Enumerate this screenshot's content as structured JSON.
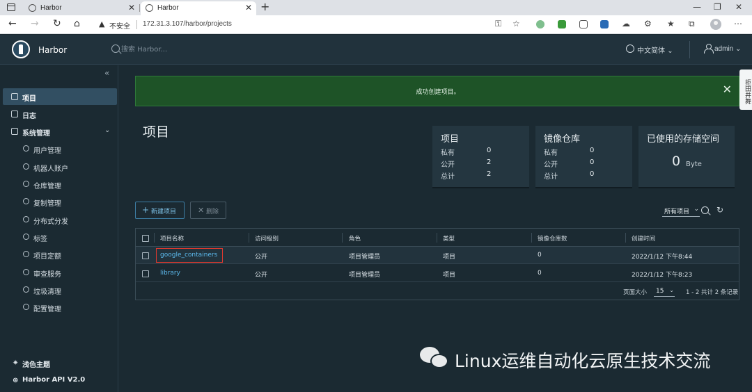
{
  "browser": {
    "tabs": [
      {
        "title": "Harbor",
        "active": false
      },
      {
        "title": "Harbor",
        "active": true
      }
    ],
    "insecure_label": "不安全",
    "url": "172.31.3.107/harbor/projects"
  },
  "header": {
    "brand": "Harbor",
    "search_placeholder": "搜索 Harbor...",
    "language": "中文简体",
    "user": "admin"
  },
  "sidebar": {
    "collapse_icon": "«",
    "items": [
      {
        "label": "项目",
        "icon": "projects-icon",
        "active": true
      },
      {
        "label": "日志",
        "icon": "logs-icon",
        "active": false
      },
      {
        "label": "系统管理",
        "icon": "admin-icon",
        "active": false
      }
    ],
    "sub_items": [
      {
        "label": "用户管理",
        "icon": "users-icon"
      },
      {
        "label": "机器人账户",
        "icon": "robot-icon"
      },
      {
        "label": "仓库管理",
        "icon": "registry-icon"
      },
      {
        "label": "复制管理",
        "icon": "replication-icon"
      },
      {
        "label": "分布式分发",
        "icon": "distribution-icon"
      },
      {
        "label": "标签",
        "icon": "tag-icon"
      },
      {
        "label": "项目定额",
        "icon": "quota-icon"
      },
      {
        "label": "审查服务",
        "icon": "scanner-icon"
      },
      {
        "label": "垃圾清理",
        "icon": "trash-icon"
      },
      {
        "label": "配置管理",
        "icon": "gear-icon"
      }
    ],
    "footer": [
      {
        "label": "浅色主题",
        "icon": "sun-icon"
      },
      {
        "label": "Harbor API V2.0",
        "icon": "api-icon"
      }
    ]
  },
  "alert": {
    "message": "成功创建项目。"
  },
  "right_tab": "拒田井舞",
  "page_title": "项目",
  "cards": {
    "projects": {
      "title": "项目",
      "rows": [
        {
          "label": "私有",
          "value": "0"
        },
        {
          "label": "公开",
          "value": "2"
        },
        {
          "label": "总计",
          "value": "2"
        }
      ]
    },
    "repositories": {
      "title": "镜像仓库",
      "rows": [
        {
          "label": "私有",
          "value": "0"
        },
        {
          "label": "公开",
          "value": "0"
        },
        {
          "label": "总计",
          "value": "0"
        }
      ]
    },
    "storage": {
      "title": "已使用的存储空间",
      "value": "0",
      "unit": "Byte"
    }
  },
  "toolbar": {
    "new_project": "新建项目",
    "delete": "删除",
    "filter": "所有项目"
  },
  "table": {
    "columns": [
      "项目名称",
      "访问级别",
      "角色",
      "类型",
      "镜像仓库数",
      "创建时间"
    ],
    "rows": [
      {
        "name": "google_containers",
        "access": "公开",
        "role": "项目管理员",
        "type": "项目",
        "repo_count": "0",
        "created": "2022/1/12 下午8:44"
      },
      {
        "name": "library",
        "access": "公开",
        "role": "项目管理员",
        "type": "项目",
        "repo_count": "0",
        "created": "2022/1/12 下午8:23"
      }
    ],
    "footer": {
      "page_size_label": "页面大小",
      "page_size": "15",
      "count": "1 - 2 共计 2 条记录"
    }
  },
  "watermark": "Linux运维自动化云原生技术交流",
  "colors": {
    "header_bg": "#21323c",
    "content_bg": "#1b2a32",
    "alert_bg": "#1e5327",
    "link": "#5cb9ec",
    "highlight": "#e0392f"
  }
}
